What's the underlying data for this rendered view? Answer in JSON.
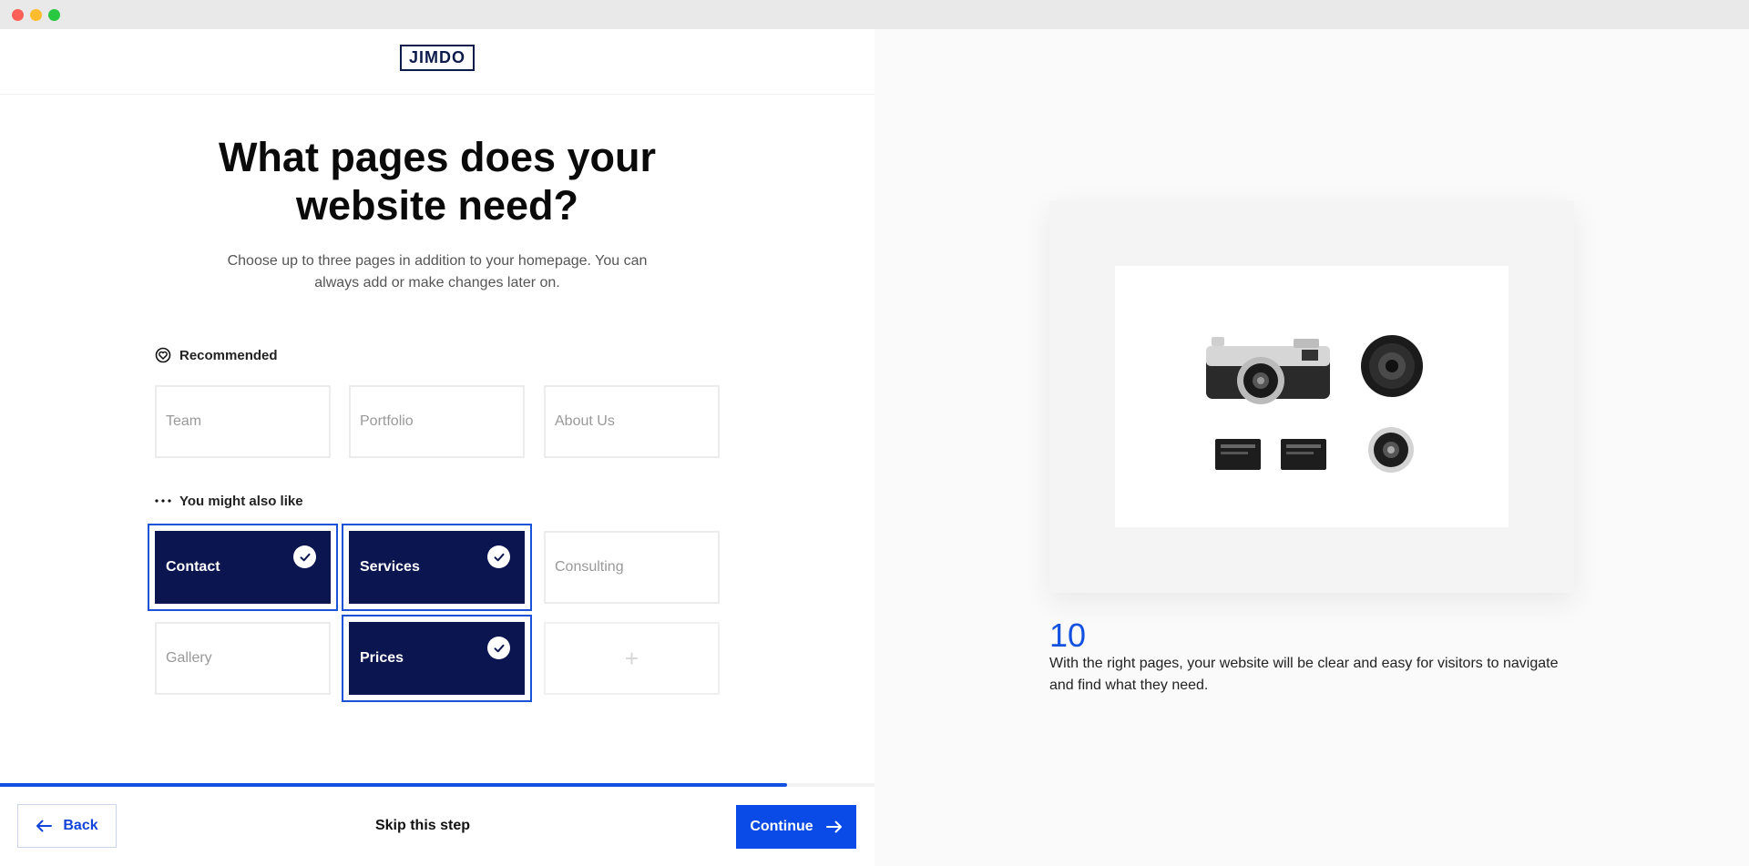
{
  "brand": {
    "logo_text": "JIMDO"
  },
  "main": {
    "heading": "What pages does your website need?",
    "subtext": "Choose up to three pages in addition to your homepage. You can always add or make changes later on."
  },
  "recommended": {
    "label": "Recommended",
    "icon": "heart-badge-icon",
    "cards": [
      {
        "label": "Team",
        "selected": false
      },
      {
        "label": "Portfolio",
        "selected": false
      },
      {
        "label": "About Us",
        "selected": false
      }
    ]
  },
  "also_like": {
    "label": "You might also like",
    "icon": "more-dots-icon",
    "cards": [
      {
        "label": "Contact",
        "selected": true
      },
      {
        "label": "Services",
        "selected": true
      },
      {
        "label": "Consulting",
        "selected": false
      },
      {
        "label": "Gallery",
        "selected": false
      },
      {
        "label": "Prices",
        "selected": true
      },
      {
        "label": "+",
        "selected": false
      }
    ]
  },
  "progress": {
    "value_fraction": 0.9
  },
  "footer": {
    "back_label": "Back",
    "skip_label": "Skip this step",
    "continue_label": "Continue"
  },
  "info": {
    "number": "10",
    "text": "With the right pages, your website will be clear and easy for visitors to navigate and find what they need."
  },
  "colors": {
    "accent": "#0a4ae6",
    "selected_card": "#0b1550",
    "logo": "#0d1b4b"
  }
}
